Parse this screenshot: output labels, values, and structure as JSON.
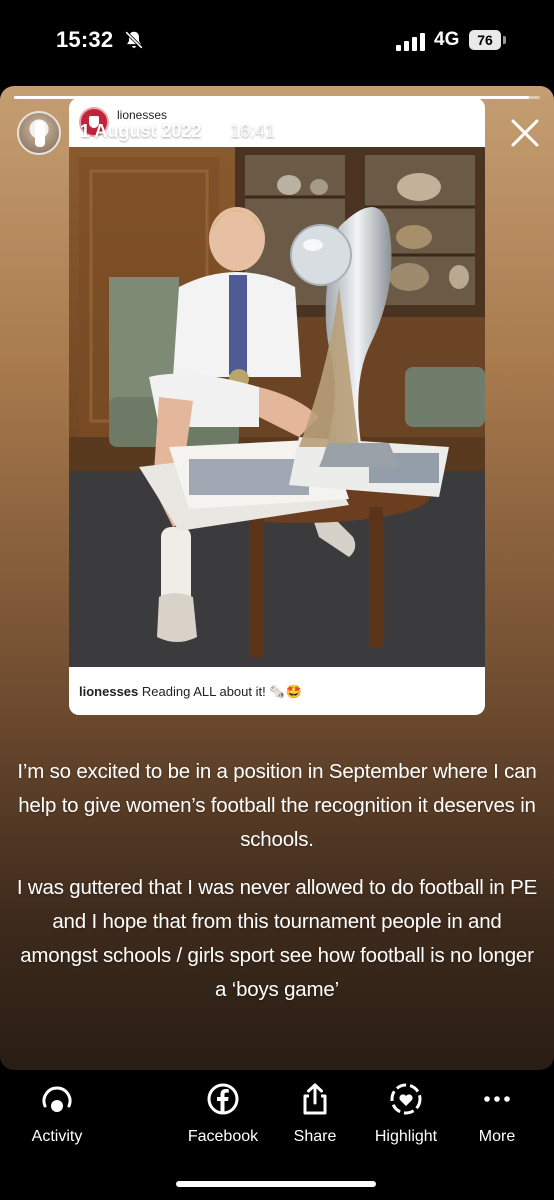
{
  "status_bar": {
    "time": "15:32",
    "network": "4G",
    "battery": "76"
  },
  "story": {
    "date": "1 August 2022",
    "time": "16:41",
    "progress": 0.98,
    "post": {
      "username": "lionesses",
      "caption_user": "lionesses",
      "caption_text": "Reading ALL about it! 🗞️🤩"
    },
    "text": {
      "paragraph1": "I’m so excited to be in a position in September where I can help to give women’s football the recognition it deserves in schools.",
      "paragraph2": "I was guttered that I was never allowed to do football in PE and I hope that from this tournament people in and amongst schools / girls sport see how football is no longer a ‘boys game’"
    }
  },
  "actions": {
    "activity": "Activity",
    "facebook": "Facebook",
    "share": "Share",
    "highlight": "Highlight",
    "more": "More"
  },
  "colors": {
    "background": "#000000",
    "story_top": "#c49e72",
    "story_bottom": "#2a1d14"
  }
}
